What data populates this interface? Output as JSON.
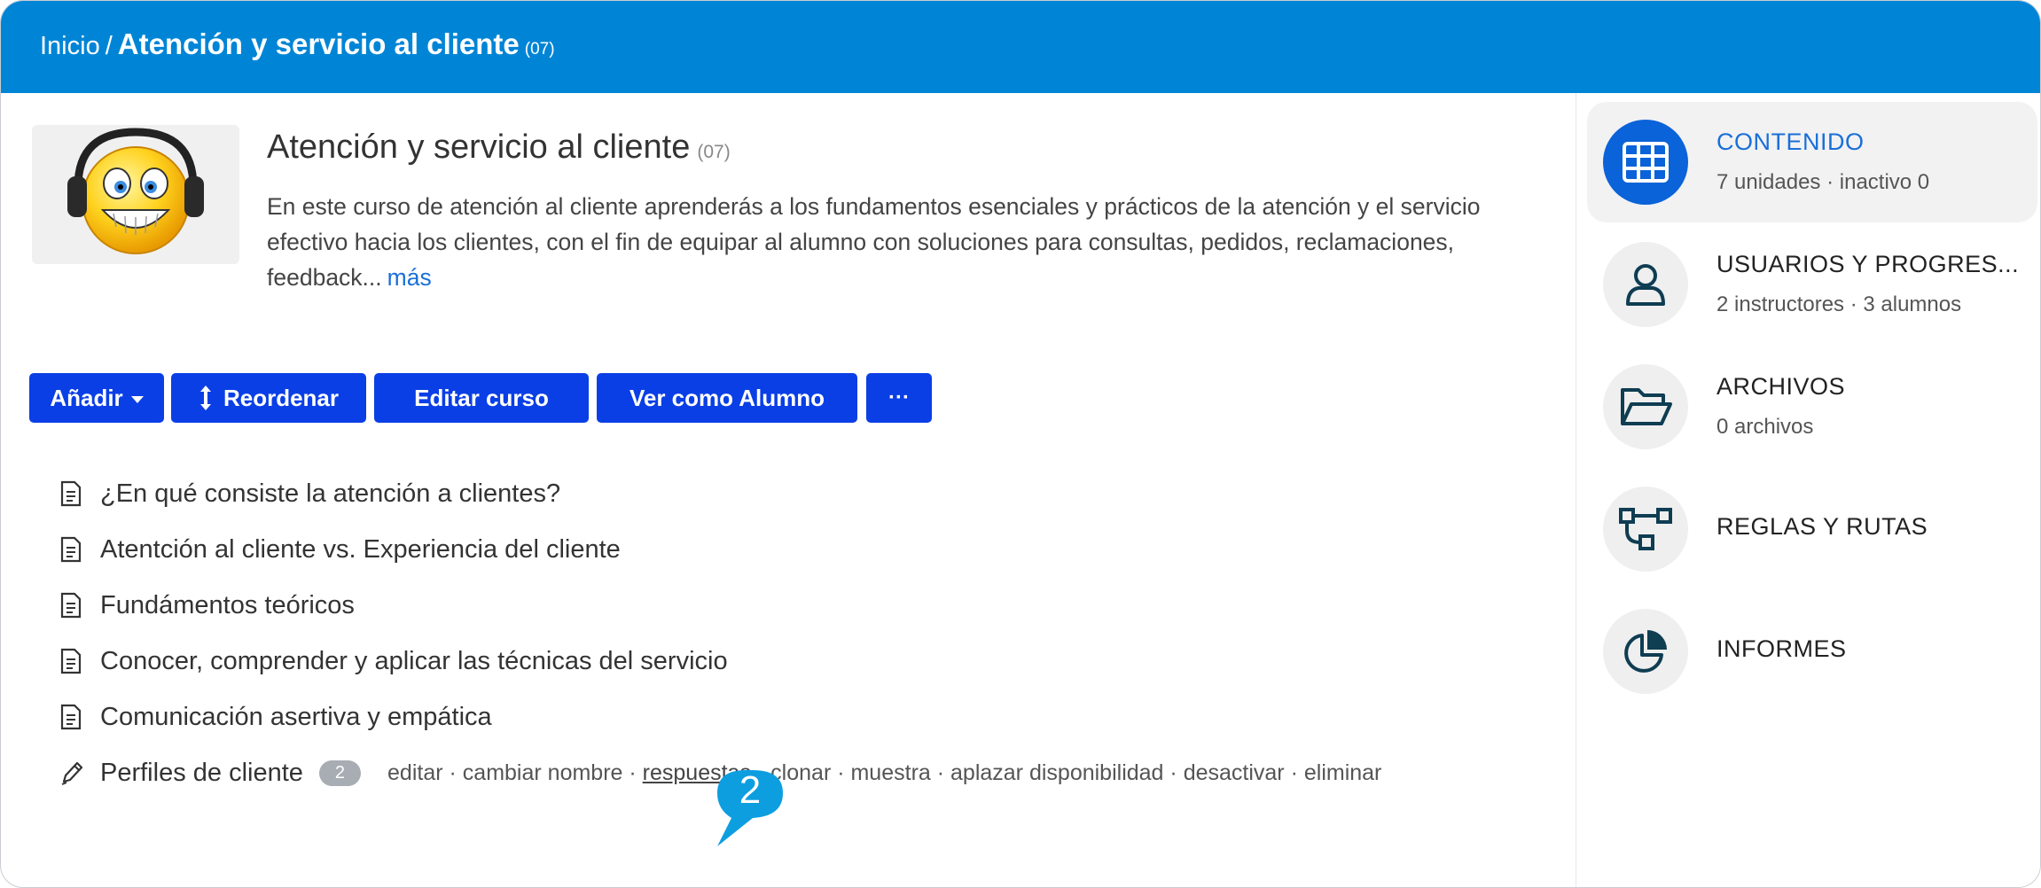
{
  "breadcrumb": {
    "home": "Inicio",
    "separator": "/",
    "current": "Atención y servicio al cliente",
    "code": "(07)"
  },
  "course": {
    "title": "Atención y servicio al cliente",
    "code": "(07)",
    "description": "En este curso de atención al cliente aprenderás a los fundamentos esenciales y prácticos de la atención y el servicio efectivo hacia los clientes, con el fin de equipar al alumno con soluciones para consultas, pedidos, reclamaciones, feedback...",
    "more_link": "más"
  },
  "toolbar": {
    "add_label": "Añadir",
    "reorder_label": "Reordenar",
    "edit_label": "Editar curso",
    "view_student_label": "Ver como Alumno",
    "more_label": "···"
  },
  "lessons": [
    {
      "title": "¿En qué consiste la atención a clientes?",
      "icon": "document-icon"
    },
    {
      "title": "Atentción al cliente vs. Experiencia del cliente",
      "icon": "document-icon"
    },
    {
      "title": "Fundámentos teóricos",
      "icon": "document-icon"
    },
    {
      "title": "Conocer, comprender y aplicar las técnicas del servicio",
      "icon": "document-icon"
    },
    {
      "title": "Comunicación asertiva y empática",
      "icon": "document-icon"
    },
    {
      "title": "Perfiles de cliente",
      "icon": "pencil-icon",
      "badge": "2"
    }
  ],
  "row_actions": {
    "edit": "editar",
    "rename": "cambiar nombre",
    "responses": "respuestas",
    "clone": "clonar",
    "sample": "muestra",
    "postpone": "aplazar disponibilidad",
    "deactivate": "desactivar",
    "delete": "eliminar",
    "separator": " · "
  },
  "callout": {
    "number": "2"
  },
  "sidebar": {
    "items": [
      {
        "label": "CONTENIDO",
        "sub": "7 unidades · inactivo 0",
        "icon": "grid-icon"
      },
      {
        "label": "USUARIOS Y PROGRES...",
        "sub": "2 instructores · 3 alumnos",
        "icon": "user-icon"
      },
      {
        "label": "ARCHIVOS",
        "sub": "0 archivos",
        "icon": "folder-icon"
      },
      {
        "label": "REGLAS Y RUTAS",
        "icon": "flow-icon"
      },
      {
        "label": "INFORMES",
        "icon": "pie-chart-icon"
      }
    ]
  },
  "colors": {
    "topbar": "#0085d6",
    "button": "#0a3fe6",
    "accent": "#1a6fd8",
    "callout": "#0d9ee0"
  }
}
